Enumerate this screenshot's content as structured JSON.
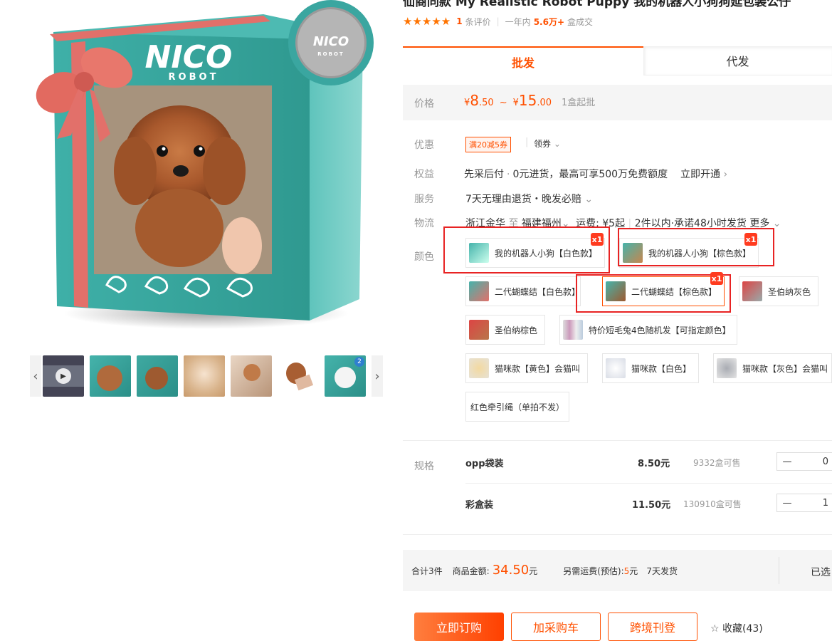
{
  "product": {
    "title": "仙商同款 My Realistic Robot Puppy 我的机器人小狗狗延包装公仔",
    "rating_stars": "★★★★★",
    "review_count": "1",
    "review_unit": "条评价",
    "sales_prefix": "一年内",
    "sales_value": "5.6万+",
    "sales_unit": "盒成交"
  },
  "gallery": {
    "brand": "NICO",
    "brand_sub": "ROBOT",
    "seal": "NICO",
    "seal_sub": "ROBOT",
    "badge_number": "2",
    "thumbnails_count": 7
  },
  "tabs": [
    {
      "label": "批发"
    },
    {
      "label": "代发"
    }
  ],
  "price": {
    "label": "价格",
    "currency": "¥",
    "low_int": "8",
    "low_dec": ".50",
    "sep": "~",
    "high_int": "15",
    "high_dec": ".00",
    "moq": "1盒起批"
  },
  "promo": {
    "label": "优惠",
    "coupon": "满20减5券",
    "claim": "领券"
  },
  "benefit": {
    "label": "权益",
    "text": "先采后付",
    "detail": "0元进货，最高可享500万免费额度",
    "action": "立即开通"
  },
  "service": {
    "label": "服务",
    "text": "7天无理由退货・晚发必赔"
  },
  "logistics": {
    "label": "物流",
    "from": "浙江金华",
    "to_word": "至",
    "to": "福建福州",
    "fee": "运费: ¥5起",
    "promise": "2件以内·承诺48小时发货",
    "more": "更多"
  },
  "color": {
    "label": "颜色",
    "options": [
      {
        "label": "我的机器人小狗【白色款】",
        "qty": "x1"
      },
      {
        "label": "我的机器人小狗【棕色款】",
        "qty": "x1"
      },
      {
        "label": "二代蝴蝶结【白色款】"
      },
      {
        "label": "二代蝴蝶结【棕色款】",
        "qty": "x1"
      },
      {
        "label": "圣伯纳灰色"
      },
      {
        "label": "圣伯纳棕色"
      },
      {
        "label": "特价短毛兔4色随机发【可指定颜色】"
      },
      {
        "label": "猫咪款【黄色】会猫叫"
      },
      {
        "label": "猫咪款【白色】"
      },
      {
        "label": "猫咪款【灰色】会猫叫"
      },
      {
        "label": "红色牵引绳（单拍不发）"
      }
    ]
  },
  "spec": {
    "label": "规格",
    "rows": [
      {
        "name": "opp袋装",
        "price": "8.50元",
        "stock": "9332盒可售",
        "minus": "—",
        "qty": "0"
      },
      {
        "name": "彩盒装",
        "price": "11.50元",
        "stock": "130910盒可售",
        "minus": "—",
        "qty": "1"
      }
    ]
  },
  "summary": {
    "total_count": "合计3件",
    "amount_label": "商品金额:",
    "amount": "34.50",
    "amount_unit": "元",
    "shipping_label": "另需运费(预估):",
    "shipping": "5",
    "shipping_unit": "元",
    "ship_time": "7天发货",
    "selected": "已选"
  },
  "actions": {
    "buy": "立即订购",
    "cart": "加采购车",
    "cross": "跨境刊登",
    "fav_icon": "☆",
    "fav": "收藏(43)"
  },
  "colors": {
    "accent": "#ff5000",
    "highlight_frame": "#e82323",
    "box_teal": "#3aa6a0"
  }
}
